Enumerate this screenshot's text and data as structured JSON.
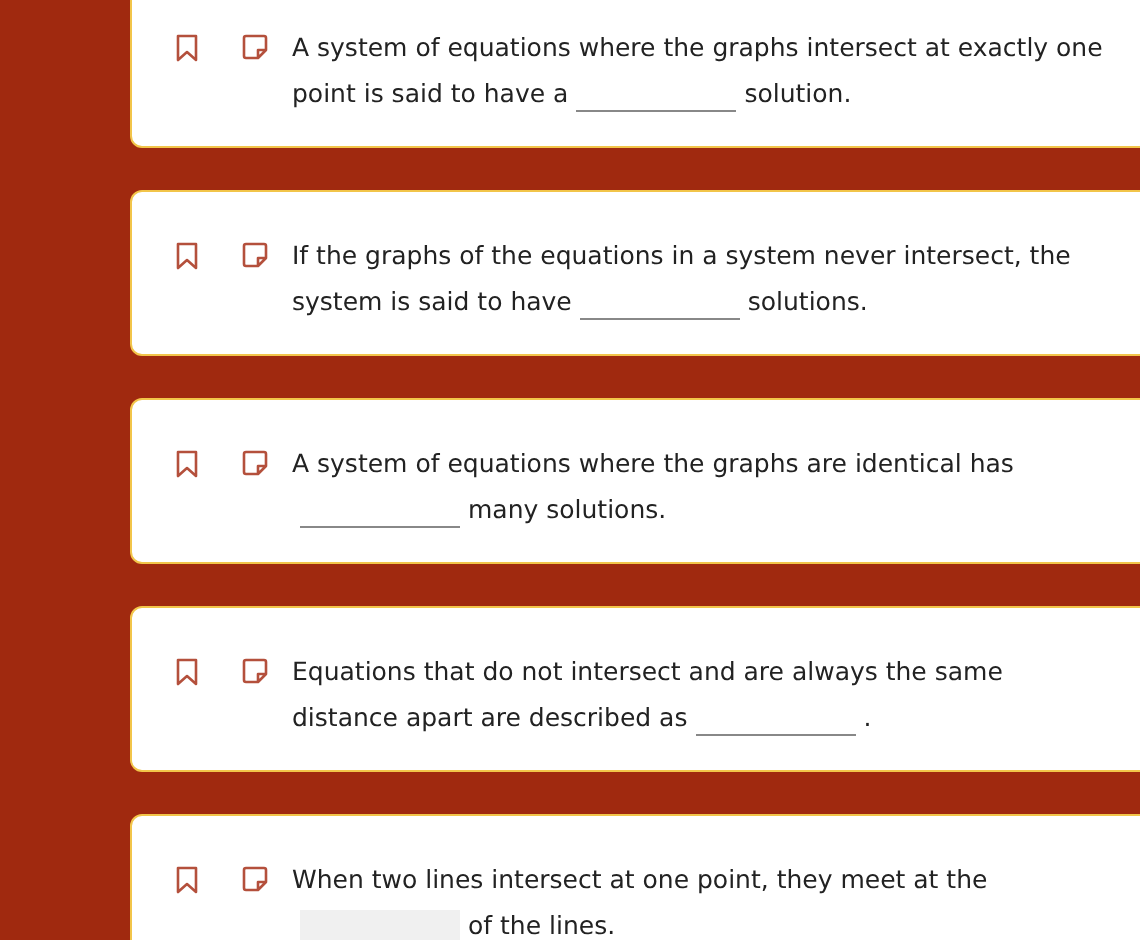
{
  "questions": [
    {
      "before": "A system of equations where the graphs intersect at exactly one point is said to have a",
      "blank": {
        "kind": "line"
      },
      "after": "solution."
    },
    {
      "before": "If the graphs of the equations in a system never intersect, the system is said to have",
      "blank": {
        "kind": "line"
      },
      "after": "solutions."
    },
    {
      "before": "A system of equations where the graphs are identical has",
      "blank": {
        "kind": "line"
      },
      "after": "many solutions."
    },
    {
      "before": "Equations that do not intersect and are always the same distance apart are described as",
      "blank": {
        "kind": "line"
      },
      "after": "."
    },
    {
      "before": "When two lines intersect at one point, they meet at the",
      "blank": {
        "kind": "shaded"
      },
      "after": "of the lines."
    }
  ]
}
